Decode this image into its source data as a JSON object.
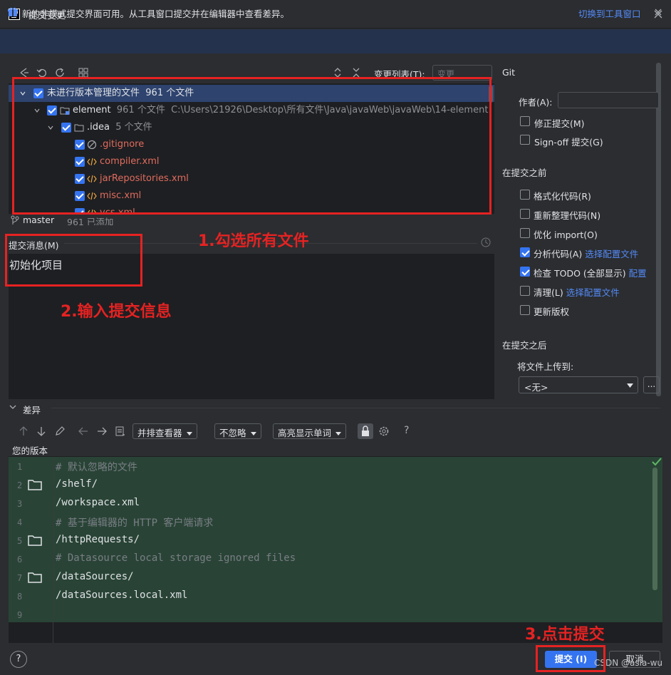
{
  "window": {
    "title": "提交变更",
    "logo": "IJ"
  },
  "banner": {
    "text": "新的非模式提交界面可用。从工具窗口提交并在编辑器中查看差异。",
    "link": "切换到工具窗口"
  },
  "toolbar": {
    "changelist_label": "变更列表(T):",
    "changelist_value": "变更"
  },
  "tree": {
    "root": {
      "label": "未进行版本管理的文件",
      "count": "961 个文件"
    },
    "module": {
      "label": "element",
      "count": "961 个文件",
      "path": "C:\\Users\\21926\\Desktop\\所有文件\\Java\\javaWeb\\javaWeb\\14-element"
    },
    "folder": {
      "label": ".idea",
      "count": "5 个文件"
    },
    "files": [
      ".gitignore",
      "compiler.xml",
      "jarRepositories.xml",
      "misc.xml",
      "vcs.xml"
    ]
  },
  "branch": {
    "name": "master",
    "added": "961 已添加"
  },
  "commit": {
    "label": "提交消息(M)",
    "message": "初始化项目"
  },
  "git_panel": {
    "title": "Git",
    "author_label": "作者(A):",
    "amend": "修正提交(M)",
    "signoff": "Sign-off 提交(G)",
    "before_title": "在提交之前",
    "reformat": "格式化代码(R)",
    "rearrange": "重新整理代码(N)",
    "optimize": "优化 import(O)",
    "analyze": "分析代码(A)",
    "analyze_link": "选择配置文件",
    "todo": "检查 TODO (全部显示)",
    "todo_link": "配置",
    "cleanup": "清理(L)",
    "cleanup_link": "选择配置文件",
    "copyright": "更新版权",
    "after_title": "在提交之后",
    "upload_label": "将文件上传到:",
    "upload_value": "<无>",
    "more": "..."
  },
  "diff": {
    "title": "差异",
    "viewer": "并排查看器",
    "ignore": "不忽略",
    "highlight": "高亮显示单词",
    "help": "?",
    "your_version": "您的版本",
    "lines": [
      {
        "n": "1",
        "text": "# 默认忽略的文件",
        "comment": true,
        "folder": false
      },
      {
        "n": "2",
        "text": "/shelf/",
        "comment": false,
        "folder": true
      },
      {
        "n": "3",
        "text": "/workspace.xml",
        "comment": false,
        "folder": false
      },
      {
        "n": "4",
        "text": "# 基于编辑器的 HTTP 客户端请求",
        "comment": true,
        "folder": false
      },
      {
        "n": "5",
        "text": "/httpRequests/",
        "comment": false,
        "folder": true
      },
      {
        "n": "6",
        "text": "# Datasource local storage ignored files",
        "comment": true,
        "folder": false
      },
      {
        "n": "7",
        "text": "/dataSources/",
        "comment": false,
        "folder": true
      },
      {
        "n": "8",
        "text": "/dataSources.local.xml",
        "comment": false,
        "folder": false
      },
      {
        "n": "9",
        "text": "",
        "comment": false,
        "folder": false
      }
    ]
  },
  "footer": {
    "help": "?",
    "commit": "提交 (I)",
    "cancel": "取消",
    "watermark": "CSDN @asia-wu"
  },
  "annotations": {
    "step1": "1.勾选所有文件",
    "step2": "2.输入提交信息",
    "step3": "3.点击提交"
  },
  "colors": {
    "accent": "#3574f0",
    "annotation": "#e62222",
    "added_bg": "#294436",
    "unversioned": "#e06c5e"
  }
}
